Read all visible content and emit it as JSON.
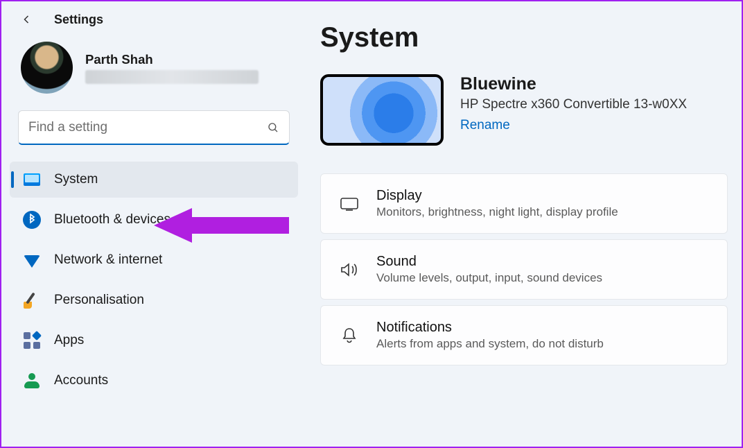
{
  "header": {
    "app_title": "Settings"
  },
  "profile": {
    "name": "Parth Shah"
  },
  "search": {
    "placeholder": "Find a setting"
  },
  "sidebar": {
    "items": [
      {
        "label": "System",
        "icon": "monitor-icon",
        "selected": true
      },
      {
        "label": "Bluetooth & devices",
        "icon": "bluetooth-icon"
      },
      {
        "label": "Network & internet",
        "icon": "wifi-icon"
      },
      {
        "label": "Personalisation",
        "icon": "paintbrush-icon"
      },
      {
        "label": "Apps",
        "icon": "apps-icon"
      },
      {
        "label": "Accounts",
        "icon": "person-icon"
      }
    ]
  },
  "page": {
    "title": "System",
    "device": {
      "name": "Bluewine",
      "model": "HP Spectre x360 Convertible 13-w0XX",
      "rename": "Rename"
    },
    "cards": [
      {
        "title": "Display",
        "subtitle": "Monitors, brightness, night light, display profile",
        "icon": "display-icon"
      },
      {
        "title": "Sound",
        "subtitle": "Volume levels, output, input, sound devices",
        "icon": "speaker-icon"
      },
      {
        "title": "Notifications",
        "subtitle": "Alerts from apps and system, do not disturb",
        "icon": "bell-icon"
      }
    ]
  }
}
